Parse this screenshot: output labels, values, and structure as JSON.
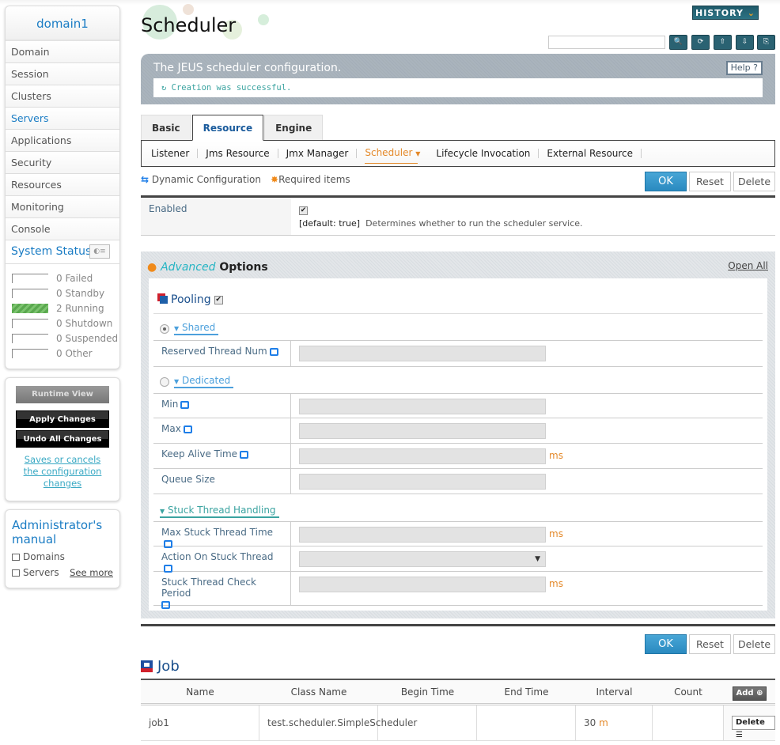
{
  "sidebar": {
    "domain_title": "domain1",
    "nav": [
      {
        "label": "Domain",
        "active": false
      },
      {
        "label": "Session",
        "active": false
      },
      {
        "label": "Clusters",
        "active": false
      },
      {
        "label": "Servers",
        "active": true
      },
      {
        "label": "Applications",
        "active": false
      },
      {
        "label": "Security",
        "active": false
      },
      {
        "label": "Resources",
        "active": false
      },
      {
        "label": "Monitoring",
        "active": false
      },
      {
        "label": "Console",
        "active": false
      }
    ],
    "system_status": {
      "title": "System Status",
      "rows": [
        {
          "count": "0",
          "label": "Failed"
        },
        {
          "count": "0",
          "label": "Standby"
        },
        {
          "count": "2",
          "label": "Running"
        },
        {
          "count": "0",
          "label": "Shutdown"
        },
        {
          "count": "0",
          "label": "Suspended"
        },
        {
          "count": "0",
          "label": "Other"
        }
      ]
    },
    "runtime_view": "Runtime View",
    "apply_changes": "Apply Changes",
    "undo_changes": "Undo All Changes",
    "save_note": "Saves or cancels the configuration changes",
    "manual": {
      "title": "Administrator's manual",
      "links": [
        "Domains",
        "Servers"
      ],
      "see_more": "See more"
    }
  },
  "header": {
    "title": "Scheduler",
    "history": "HISTORY",
    "search_placeholder": "",
    "toolbar_icons": [
      "search-icon",
      "refresh-icon",
      "xml-upload-icon",
      "xml-download-icon",
      "export-icon"
    ]
  },
  "info": {
    "description": "The JEUS scheduler configuration.",
    "help": "Help",
    "message": "Creation was successful."
  },
  "tabs": [
    {
      "label": "Basic",
      "active": false
    },
    {
      "label": "Resource",
      "active": true
    },
    {
      "label": "Engine",
      "active": false
    }
  ],
  "subnav": [
    {
      "label": "Listener",
      "active": false
    },
    {
      "label": "Jms Resource",
      "active": false
    },
    {
      "label": "Jmx Manager",
      "active": false
    },
    {
      "label": "Scheduler",
      "active": true
    },
    {
      "label": "Lifecycle Invocation",
      "active": false
    },
    {
      "label": "External Resource",
      "active": false
    }
  ],
  "legend": {
    "dynamic": "Dynamic Configuration",
    "required": "Required items"
  },
  "buttons": {
    "ok": "OK",
    "reset": "Reset",
    "delete": "Delete"
  },
  "enabled": {
    "label": "Enabled",
    "checked": true,
    "default": "[default: true]",
    "description": "Determines whether to run the scheduler service."
  },
  "advanced": {
    "title_em": "Advanced",
    "title_rest": " Options",
    "open_all": "Open All",
    "pooling": {
      "label": "Pooling",
      "checked": true
    },
    "shared": {
      "label": "Shared",
      "selected": true,
      "fields": [
        {
          "label": "Reserved Thread Num",
          "value": "",
          "unit": ""
        }
      ]
    },
    "dedicated": {
      "label": "Dedicated",
      "selected": false,
      "fields": [
        {
          "label": "Min",
          "value": "",
          "unit": ""
        },
        {
          "label": "Max",
          "value": "",
          "unit": ""
        },
        {
          "label": "Keep Alive Time",
          "value": "",
          "unit": "ms"
        },
        {
          "label": "Queue Size",
          "value": "",
          "unit": ""
        }
      ]
    },
    "stuck": {
      "label": "Stuck Thread Handling",
      "fields": [
        {
          "label": "Max Stuck Thread Time",
          "value": "",
          "unit": "ms"
        },
        {
          "label": "Action On Stuck Thread",
          "value": "",
          "unit": ""
        },
        {
          "label": "Stuck Thread Check Period",
          "value": "",
          "unit": "ms"
        }
      ]
    }
  },
  "job": {
    "title": "Job",
    "columns": [
      "Name",
      "Class Name",
      "Begin Time",
      "End Time",
      "Interval",
      "Count"
    ],
    "add": "Add",
    "rows": [
      {
        "name": "job1",
        "class_name": "test.scheduler.SimpleScheduler",
        "begin_time": "",
        "end_time": "",
        "interval": "30",
        "interval_unit": "m",
        "count": "",
        "delete": "Delete"
      }
    ]
  },
  "colors": {
    "accent": "#1a7cc4",
    "ok": "#2a8ac0",
    "unit": "#e4892a",
    "running": "#5aa84f"
  }
}
